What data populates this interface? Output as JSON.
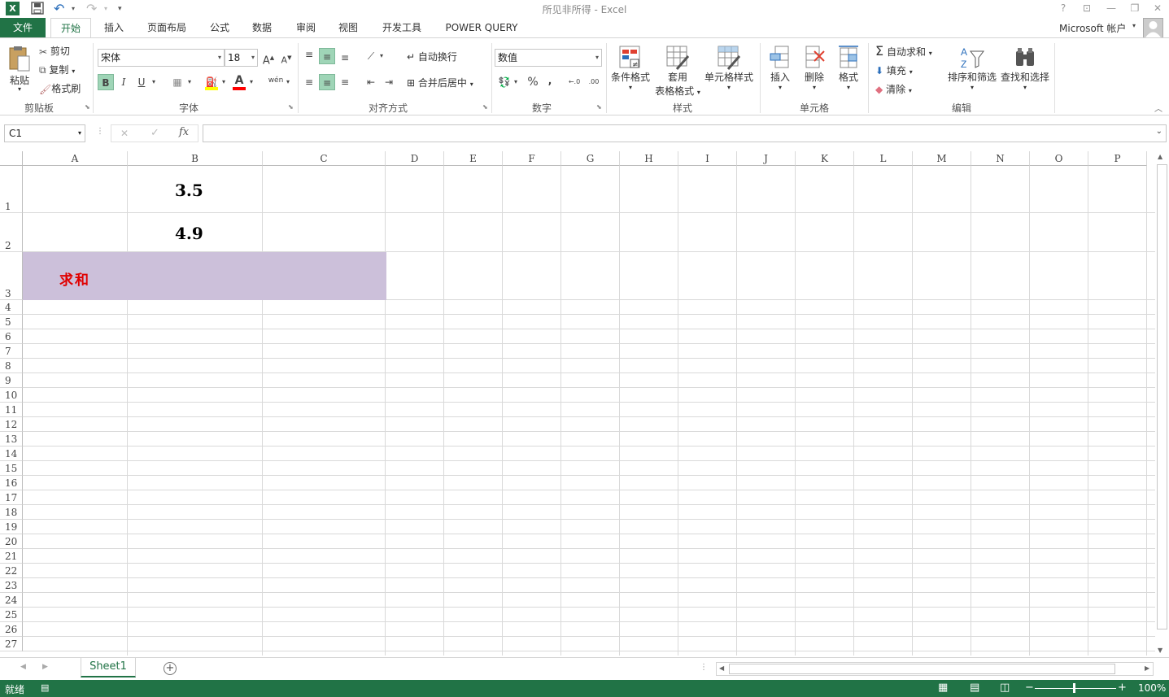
{
  "title": "所见非所得 - Excel",
  "tabs": {
    "file": "文件",
    "home": "开始",
    "insert": "插入",
    "layout": "页面布局",
    "formulas": "公式",
    "data": "数据",
    "review": "审阅",
    "view": "视图",
    "developer": "开发工具",
    "powerquery": "POWER QUERY"
  },
  "account": "Microsoft 帐户",
  "clipboard": {
    "paste": "粘贴",
    "cut": "剪切",
    "copy": "复制",
    "format_painter": "格式刷",
    "label": "剪贴板"
  },
  "font": {
    "name": "宋体",
    "size": "18",
    "grow": "A",
    "shrink": "A",
    "bold": "B",
    "italic": "I",
    "underline": "U",
    "font_color_letter": "A",
    "phonetic": "wén",
    "label": "字体"
  },
  "alignment": {
    "wrap": "自动换行",
    "merge": "合并后居中",
    "label": "对齐方式"
  },
  "number": {
    "format": "数值",
    "percent": "%",
    "comma": ",",
    "label": "数字"
  },
  "styles": {
    "conditional": "条件格式",
    "table_format_1": "套用",
    "table_format_2": "表格格式",
    "cell_styles": "单元格样式",
    "label": "样式"
  },
  "cells": {
    "insert": "插入",
    "delete": "删除",
    "format": "格式",
    "label": "单元格"
  },
  "editing": {
    "autosum": "自动求和",
    "fill": "填充",
    "clear": "清除",
    "sort": "排序和筛选",
    "find": "查找和选择",
    "label": "编辑"
  },
  "formula_bar": {
    "name_box": "C1",
    "fx": "fx",
    "cancel": "✕",
    "enter": "✓",
    "content": ""
  },
  "columns": [
    "A",
    "B",
    "C",
    "D",
    "E",
    "F",
    "G",
    "H",
    "I",
    "J",
    "K",
    "L",
    "M",
    "N",
    "O",
    "P"
  ],
  "rows": [
    "1",
    "2",
    "3",
    "4",
    "5",
    "6",
    "7",
    "8",
    "9",
    "10",
    "11",
    "12",
    "13",
    "14",
    "15",
    "16",
    "17",
    "18",
    "19",
    "20",
    "21",
    "22",
    "23",
    "24",
    "25",
    "26",
    "27"
  ],
  "cells_data": {
    "B1": "3.5",
    "B2": "4.9",
    "A3": "求和"
  },
  "merged_fill_color": "#ccc0da",
  "sum_text_color": "#e00000",
  "accent": "#217346",
  "sheet": {
    "name": "Sheet1",
    "add": "+"
  },
  "status": {
    "ready": "就绪",
    "zoom": "100%",
    "zoom_minus": "−",
    "zoom_plus": "+"
  }
}
